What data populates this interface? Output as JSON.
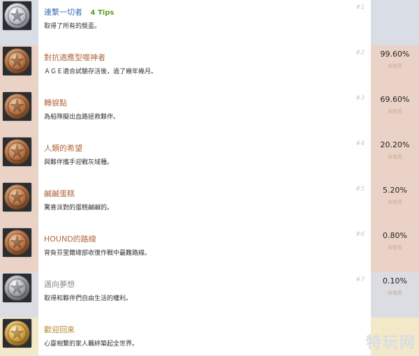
{
  "achievements": [
    {
      "title": "連繫一切者",
      "tips": "4 Tips",
      "desc": "取得了所有的獎盃。",
      "num": "#1",
      "percent": "",
      "rate_label": "",
      "medal": "platinum-trophy-icon",
      "rarity_color": "#d9dde6",
      "title_color": "#3d6fb4"
    },
    {
      "title": "對抗適應型噬神者",
      "tips": "",
      "desc": "ＡＧＥ適合試驗存活後，過了幾年幾月。",
      "num": "#2",
      "percent": "99.60%",
      "rate_label": "非常高",
      "medal": "bronze-trophy-icon",
      "rarity_color": "#ead3c6",
      "title_color": "#b0683c"
    },
    {
      "title": "轉捩點",
      "tips": "",
      "desc": "為船隊擬出血路拯救夥伴。",
      "num": "#3",
      "percent": "69.60%",
      "rate_label": "非常高",
      "medal": "bronze-trophy-icon",
      "rarity_color": "#ead3c6",
      "title_color": "#b0683c"
    },
    {
      "title": "人類的希望",
      "tips": "",
      "desc": "與夥伴攜手迎戰灰域種。",
      "num": "#4",
      "percent": "20.20%",
      "rate_label": "非常高",
      "medal": "bronze-trophy-icon",
      "rarity_color": "#ead3c6",
      "title_color": "#b0683c"
    },
    {
      "title": "鹹鹹蛋糕",
      "tips": "",
      "desc": "驚喜派對的蛋糕鹹鹹的。",
      "num": "#5",
      "percent": "5.20%",
      "rate_label": "非常高",
      "medal": "bronze-trophy-icon",
      "rarity_color": "#ead3c6",
      "title_color": "#b0683c"
    },
    {
      "title": "HOUND的路線",
      "tips": "",
      "desc": "背負芬里爾總部收復作戰中最難路線。",
      "num": "#6",
      "percent": "0.80%",
      "rate_label": "非常高",
      "medal": "bronze-trophy-icon",
      "rarity_color": "#ead3c6",
      "title_color": "#b0683c"
    },
    {
      "title": "邁向夢想",
      "tips": "",
      "desc": "取得和夥伴們自由生活的權利。",
      "num": "#7",
      "percent": "0.10%",
      "rate_label": "非常高",
      "medal": "silver-trophy-icon",
      "rarity_color": "#dcdde3",
      "title_color": "#8a8a8a"
    },
    {
      "title": "歡迎回來",
      "tips": "",
      "desc": "心靈相繫的家人羈絆築起全世界。",
      "num": "",
      "percent": "",
      "rate_label": "",
      "medal": "gold-trophy-icon",
      "rarity_color": "#f3e8c8",
      "title_color": "#b8852a"
    }
  ],
  "watermark": "特玩网"
}
